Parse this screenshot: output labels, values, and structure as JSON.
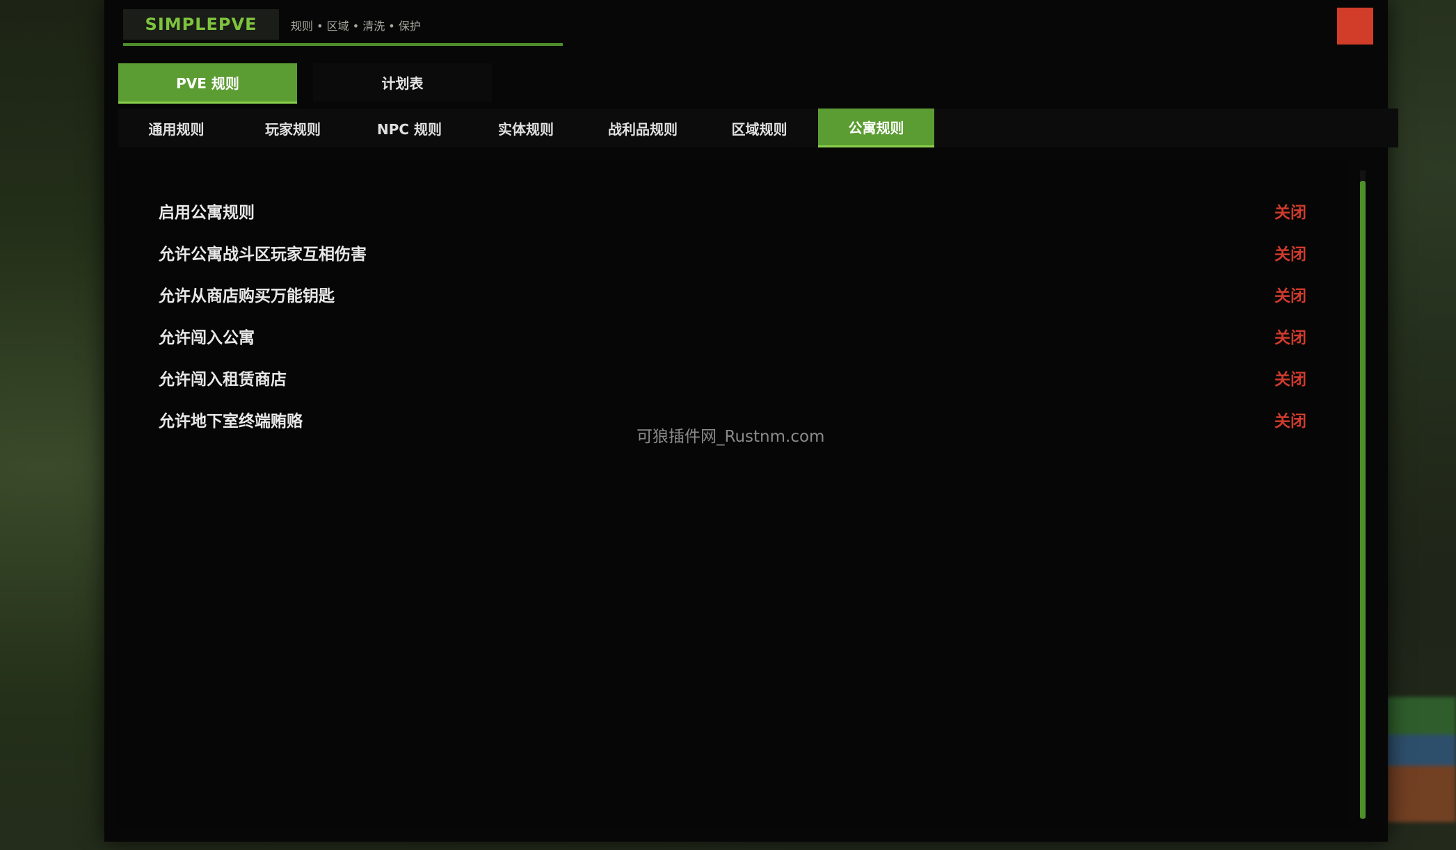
{
  "brand": {
    "title": "SIMPLEPVE",
    "subtitle": "规则 • 区域 • 清洗 • 保护"
  },
  "main_tabs": [
    {
      "label": "PVE 规则",
      "active": true
    },
    {
      "label": "计划表",
      "active": false
    }
  ],
  "sub_tabs": [
    {
      "label": "通用规则",
      "active": false
    },
    {
      "label": "玩家规则",
      "active": false
    },
    {
      "label": "NPC 规则",
      "active": false
    },
    {
      "label": "实体规则",
      "active": false
    },
    {
      "label": "战利品规则",
      "active": false
    },
    {
      "label": "区域规则",
      "active": false
    },
    {
      "label": "公寓规则",
      "active": true
    }
  ],
  "rules": [
    {
      "label": "启用公寓规则",
      "status": "关闭"
    },
    {
      "label": "允许公寓战斗区玩家互相伤害",
      "status": "关闭"
    },
    {
      "label": "允许从商店购买万能钥匙",
      "status": "关闭"
    },
    {
      "label": "允许闯入公寓",
      "status": "关闭"
    },
    {
      "label": "允许闯入租赁商店",
      "status": "关闭"
    },
    {
      "label": "允许地下室终端贿赂",
      "status": "关闭"
    }
  ],
  "watermark": "可狼插件网_Rustnm.com",
  "colors": {
    "accent": "#5c9d33",
    "brand_text": "#7ec33e",
    "status_off": "#cf3b2d",
    "close_button": "#d23d2a"
  },
  "icons": {
    "close": "close-button-square"
  }
}
